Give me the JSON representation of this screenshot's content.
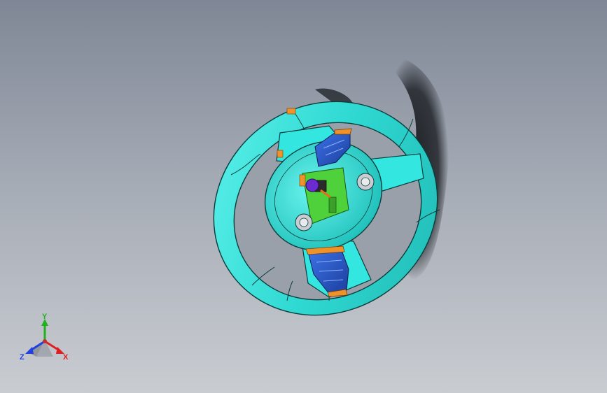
{
  "viewport": {
    "background_top": "#7f8796",
    "background_bottom": "#c9ccd1"
  },
  "model": {
    "name": "steering-wheel-assembly",
    "colors": {
      "rim": "#33e6e0",
      "rim_edge": "#0a3d3c",
      "hub": "#39e0d8",
      "buttons": "#2a57c8",
      "trim": "#f0922a",
      "pcb": "#4ed13b",
      "paddle": "#8a2be2",
      "shadow": "#1a1d22"
    }
  },
  "triad": {
    "x_label": "X",
    "y_label": "Y",
    "z_label": "Z",
    "x_color": "#e02020",
    "y_color": "#20b020",
    "z_color": "#2040e0"
  }
}
